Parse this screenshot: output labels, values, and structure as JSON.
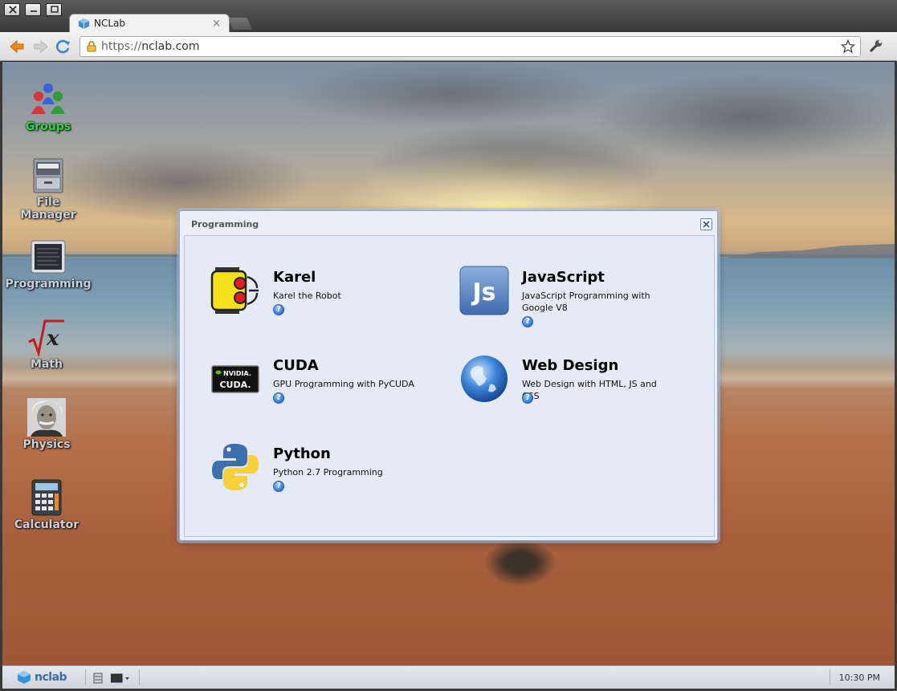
{
  "window": {
    "tab_title": "NCLab",
    "tab_close": "×"
  },
  "toolbar": {
    "url_protocol": "https://",
    "url_host": "nclab.com"
  },
  "desktop_icons": [
    {
      "label": "Groups",
      "icon": "groups-icon"
    },
    {
      "label": "File Manager",
      "icon": "file-cabinet-icon"
    },
    {
      "label": "Programming",
      "icon": "programming-icon"
    },
    {
      "label": "Math",
      "icon": "sqrt-x-icon"
    },
    {
      "label": "Physics",
      "icon": "einstein-icon"
    },
    {
      "label": "Calculator",
      "icon": "calculator-icon"
    }
  ],
  "dialog": {
    "title": "Programming",
    "apps": [
      {
        "name": "Karel",
        "desc": "Karel the Robot",
        "icon": "karel-robot-icon"
      },
      {
        "name": "JavaScript",
        "desc": "JavaScript Programming with Google V8",
        "icon": "js-icon"
      },
      {
        "name": "CUDA",
        "desc": "GPU Programming with PyCUDA",
        "icon": "nvidia-cuda-icon"
      },
      {
        "name": "Web Design",
        "desc": "Web Design with HTML, JS and CSS",
        "icon": "globe-icon"
      },
      {
        "name": "Python",
        "desc": "Python 2.7 Programming",
        "icon": "python-icon"
      }
    ],
    "help_glyph": "?"
  },
  "taskbar": {
    "logo_text": "nclab",
    "clock": "10:30 PM"
  },
  "colors": {
    "groups_label": "#33d64a",
    "dialog_bg": "#e4ebf7",
    "help_blue": "#2f73d8"
  }
}
